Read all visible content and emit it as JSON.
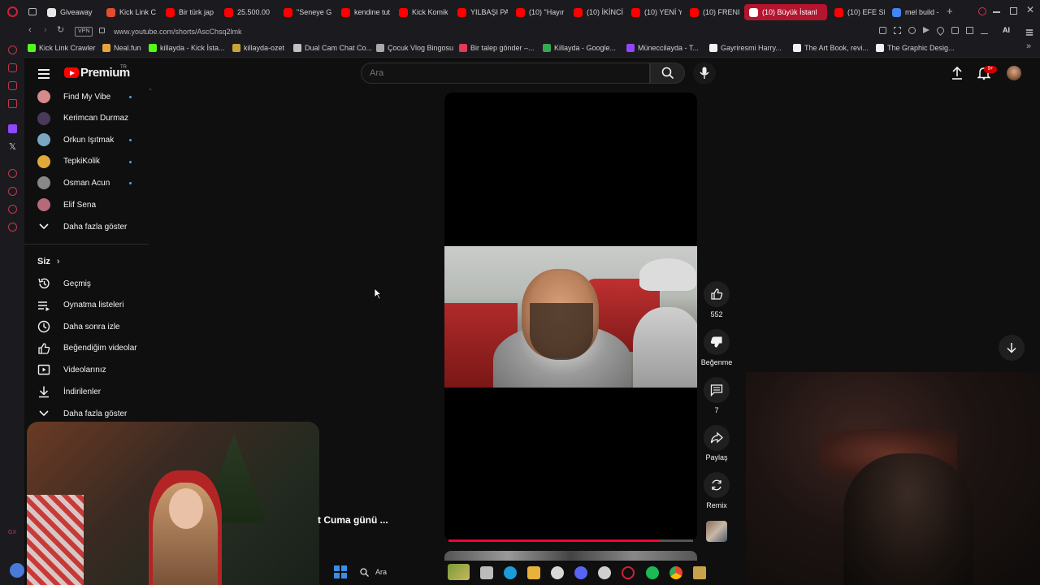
{
  "browser": {
    "tabs": [
      {
        "label": "Giveaway",
        "color": "#e8e8e8"
      },
      {
        "label": "Kick Link C",
        "color": "#e34d2f"
      },
      {
        "label": "Bir türk jap",
        "color": "#ff0000"
      },
      {
        "label": "25.500.00",
        "color": "#ff0000"
      },
      {
        "label": "\"Seneye G",
        "color": "#ff0000"
      },
      {
        "label": "kendine tut",
        "color": "#ff0000"
      },
      {
        "label": "Kick Komik",
        "color": "#ff0000"
      },
      {
        "label": "YILBAŞI PA",
        "color": "#ff0000"
      },
      {
        "label": "(10) \"Hayır",
        "color": "#ff0000"
      },
      {
        "label": "(10) İKİNCİ",
        "color": "#ff0000"
      },
      {
        "label": "(10) YENİ Y",
        "color": "#ff0000"
      },
      {
        "label": "(10) FRENI",
        "color": "#ff0000"
      },
      {
        "label": "(10) Büyük İstanl",
        "color": "#ffffff"
      },
      {
        "label": "(10) EFE SI",
        "color": "#ff0000"
      },
      {
        "label": "mel build -",
        "color": "#4285f4"
      }
    ],
    "url": "www.youtube.com/shorts/AscChsq2lmk",
    "vpn_label": "VPN",
    "ai_label": "AI",
    "bookmarks": [
      "Kick Link Crawler",
      "Neal.fun",
      "killayda - Kick İsta...",
      "killayda-ozet",
      "Dual Cam Chat Co...",
      "Çocuk Vlog Bingosu",
      "Bir talep gönder –...",
      "Killayda - Google...",
      "Müneccilayda - T...",
      "Gayriresmi Harry...",
      "The Art Book, revi...",
      "The Graphic Desig..."
    ]
  },
  "youtube": {
    "logo_text": "Premium",
    "logo_region": "TR",
    "search_placeholder": "Ara",
    "notification_badge": "9+",
    "subscriptions": [
      {
        "label": "Find My Vibe",
        "dot": true,
        "color": "#d68a8a"
      },
      {
        "label": "Kerimcan Durmaz",
        "dot": false,
        "color": "#4a3a5a"
      },
      {
        "label": "Orkun Işıtmak",
        "dot": true,
        "color": "#7aa6c2"
      },
      {
        "label": "TepkiKolik",
        "dot": true,
        "color": "#e2a83a"
      },
      {
        "label": "Osman Acun",
        "dot": true,
        "color": "#888888"
      },
      {
        "label": "Elif Sena",
        "dot": false,
        "color": "#b56a7a"
      }
    ],
    "show_more_1": "Daha fazla göster",
    "section_you": "Siz",
    "you_items": [
      {
        "label": "Geçmiş",
        "icon": "history-icon"
      },
      {
        "label": "Oynatma listeleri",
        "icon": "playlist-icon"
      },
      {
        "label": "Daha sonra izle",
        "icon": "clock-icon"
      },
      {
        "label": "Beğendiğim videolar",
        "icon": "thumbs-up-icon"
      },
      {
        "label": "Videolarınız",
        "icon": "video-icon"
      },
      {
        "label": "İndirilenler",
        "icon": "download-icon"
      }
    ],
    "show_more_2": "Daha fazla göster",
    "actions": {
      "like_count": "552",
      "dislike_label": "Beğenme",
      "comment_count": "7",
      "share_label": "Paylaş",
      "remix_label": "Remix"
    },
    "progress": 0.86
  },
  "stream": {
    "caption": "t Cuma günü ..."
  },
  "taskbar": {
    "search_label": "Ara"
  }
}
